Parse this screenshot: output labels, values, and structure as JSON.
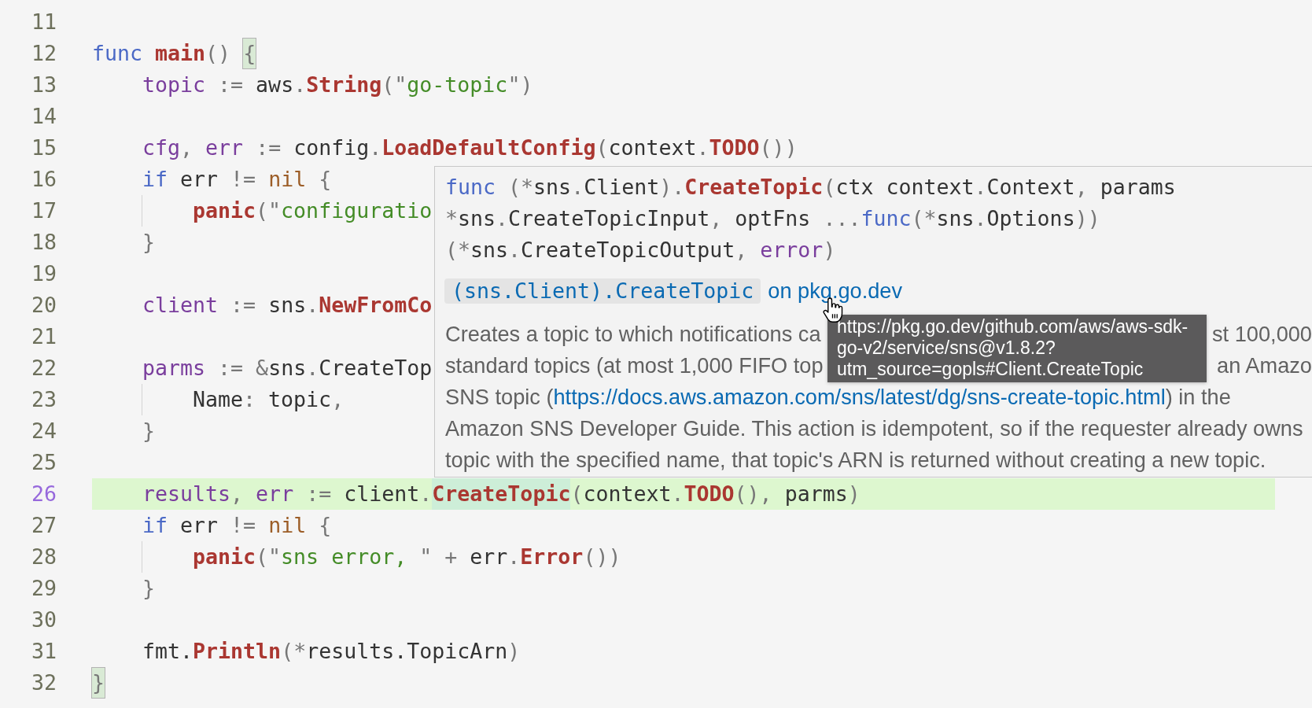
{
  "editor": {
    "lines": [
      {
        "number": "11",
        "current": false
      },
      {
        "number": "12",
        "current": false,
        "tokens": [
          {
            "kind": "keyword",
            "text": "func ",
            "matched": false
          },
          {
            "kind": "function",
            "text": "main",
            "matched": false
          },
          {
            "kind": "punct",
            "text": "() ",
            "matched": false
          },
          {
            "kind": "punct",
            "text": "{",
            "matched": true
          }
        ],
        "children": [
          {
            "number": "13",
            "current": false,
            "tokens": [
              {
                "kind": "variable",
                "text": "topic"
              },
              {
                "kind": "punct",
                "text": " := "
              },
              {
                "kind": "plain",
                "text": "aws"
              },
              {
                "kind": "punct",
                "text": "."
              },
              {
                "kind": "function",
                "text": "String"
              },
              {
                "kind": "punct",
                "text": "(\""
              },
              {
                "kind": "string",
                "text": "go-topic"
              },
              {
                "kind": "punct",
                "text": "\")"
              }
            ]
          },
          {
            "number": "14",
            "current": false
          },
          {
            "number": "15",
            "current": false,
            "tokens": [
              {
                "kind": "variable",
                "text": "cfg"
              },
              {
                "kind": "punct",
                "text": ", "
              },
              {
                "kind": "variable",
                "text": "err"
              },
              {
                "kind": "punct",
                "text": " := "
              },
              {
                "kind": "plain",
                "text": "config"
              },
              {
                "kind": "punct",
                "text": "."
              },
              {
                "kind": "function",
                "text": "LoadDefaultConfig"
              },
              {
                "kind": "punct",
                "text": "("
              },
              {
                "kind": "plain",
                "text": "context"
              },
              {
                "kind": "punct",
                "text": "."
              },
              {
                "kind": "function",
                "text": "TODO"
              },
              {
                "kind": "punct",
                "text": "())"
              }
            ]
          },
          {
            "number": "16",
            "current": false,
            "tokens": [
              {
                "kind": "keyword",
                "text": "if "
              },
              {
                "kind": "plain",
                "text": "err "
              },
              {
                "kind": "punct",
                "text": "!= "
              },
              {
                "kind": "constant",
                "text": "nil "
              },
              {
                "kind": "punct",
                "text": "{"
              }
            ],
            "children": [
              {
                "number": "17",
                "current": false,
                "tokens": [
                  {
                    "kind": "function",
                    "text": "panic"
                  },
                  {
                    "kind": "punct",
                    "text": "(\""
                  },
                  {
                    "kind": "string",
                    "text": "configuratio"
                  }
                ]
              }
            ]
          },
          {
            "number": "18",
            "current": false,
            "tokens": [
              {
                "kind": "punct",
                "text": "}"
              }
            ]
          },
          {
            "number": "19",
            "current": false
          },
          {
            "number": "20",
            "current": false,
            "tokens": [
              {
                "kind": "variable",
                "text": "client"
              },
              {
                "kind": "punct",
                "text": " := "
              },
              {
                "kind": "plain",
                "text": "sns"
              },
              {
                "kind": "punct",
                "text": "."
              },
              {
                "kind": "function",
                "text": "NewFromCo"
              }
            ]
          },
          {
            "number": "21",
            "current": false
          },
          {
            "number": "22",
            "current": false,
            "tokens": [
              {
                "kind": "variable",
                "text": "parms"
              },
              {
                "kind": "punct",
                "text": " := &"
              },
              {
                "kind": "plain",
                "text": "sns"
              },
              {
                "kind": "punct",
                "text": "."
              },
              {
                "kind": "plain",
                "text": "CreateTop"
              }
            ],
            "children": [
              {
                "number": "23",
                "current": false,
                "tokens": [
                  {
                    "kind": "plain",
                    "text": "Name"
                  },
                  {
                    "kind": "punct",
                    "text": ": "
                  },
                  {
                    "kind": "plain",
                    "text": "topic"
                  },
                  {
                    "kind": "punct",
                    "text": ","
                  }
                ]
              }
            ]
          },
          {
            "number": "24",
            "current": false,
            "tokens": [
              {
                "kind": "punct",
                "text": "}"
              }
            ]
          },
          {
            "number": "25",
            "current": false
          },
          {
            "number": "26",
            "current": true,
            "tokens": [
              {
                "kind": "variable",
                "text": "results",
                "hovered": false
              },
              {
                "kind": "punct",
                "text": ", ",
                "hovered": false
              },
              {
                "kind": "variable",
                "text": "err",
                "hovered": false
              },
              {
                "kind": "punct",
                "text": " := ",
                "hovered": false
              },
              {
                "kind": "plain",
                "text": "client",
                "hovered": false
              },
              {
                "kind": "punct",
                "text": ".",
                "hovered": false
              },
              {
                "kind": "function",
                "text": "CreateTopic",
                "hovered": true
              },
              {
                "kind": "punct",
                "text": "(",
                "hovered": false
              },
              {
                "kind": "plain",
                "text": "context",
                "hovered": false
              },
              {
                "kind": "punct",
                "text": ".",
                "hovered": false
              },
              {
                "kind": "function",
                "text": "TODO",
                "hovered": false
              },
              {
                "kind": "punct",
                "text": "(), ",
                "hovered": false
              },
              {
                "kind": "plain",
                "text": "parms",
                "hovered": false
              },
              {
                "kind": "punct",
                "text": ")",
                "hovered": false
              }
            ]
          },
          {
            "number": "27",
            "current": false,
            "tokens": [
              {
                "kind": "keyword",
                "text": "if "
              },
              {
                "kind": "plain",
                "text": "err "
              },
              {
                "kind": "punct",
                "text": "!= "
              },
              {
                "kind": "constant",
                "text": "nil "
              },
              {
                "kind": "punct",
                "text": "{"
              }
            ],
            "children": [
              {
                "number": "28",
                "current": false,
                "tokens": [
                  {
                    "kind": "function",
                    "text": "panic"
                  },
                  {
                    "kind": "punct",
                    "text": "(\""
                  },
                  {
                    "kind": "string",
                    "text": "sns error, "
                  },
                  {
                    "kind": "punct",
                    "text": "\" + "
                  },
                  {
                    "kind": "plain",
                    "text": "err"
                  },
                  {
                    "kind": "punct",
                    "text": "."
                  },
                  {
                    "kind": "function",
                    "text": "Error"
                  },
                  {
                    "kind": "punct",
                    "text": "())"
                  }
                ]
              }
            ]
          },
          {
            "number": "29",
            "current": false,
            "tokens": [
              {
                "kind": "punct",
                "text": "}"
              }
            ]
          },
          {
            "number": "30",
            "current": false
          },
          {
            "number": "31",
            "current": false,
            "tokens": [
              {
                "kind": "plain",
                "text": "fmt."
              },
              {
                "kind": "function",
                "text": "Println"
              },
              {
                "kind": "punct",
                "text": "(*"
              },
              {
                "kind": "plain",
                "text": "results.TopicArn"
              },
              {
                "kind": "punct",
                "text": ")"
              }
            ]
          }
        ]
      },
      {
        "number": "32",
        "current": false,
        "tokens": [
          {
            "kind": "punct",
            "text": "}",
            "matched": true
          }
        ]
      }
    ]
  },
  "hover": {
    "signature": [
      {
        "tokens": [
          {
            "kind": "keyword",
            "text": "func "
          },
          {
            "kind": "punct",
            "text": "(*"
          },
          {
            "kind": "plain",
            "text": "sns"
          },
          {
            "kind": "punct",
            "text": "."
          },
          {
            "kind": "plain",
            "text": "Client"
          },
          {
            "kind": "punct",
            "text": ")."
          },
          {
            "kind": "function",
            "text": "CreateTopic"
          },
          {
            "kind": "punct",
            "text": "("
          },
          {
            "kind": "plain",
            "text": "ctx context"
          },
          {
            "kind": "punct",
            "text": "."
          },
          {
            "kind": "plain",
            "text": "Context"
          },
          {
            "kind": "punct",
            "text": ", "
          },
          {
            "kind": "plain",
            "text": "params"
          }
        ]
      },
      {
        "tokens": [
          {
            "kind": "punct",
            "text": "*"
          },
          {
            "kind": "plain",
            "text": "sns"
          },
          {
            "kind": "punct",
            "text": "."
          },
          {
            "kind": "plain",
            "text": "CreateTopicInput"
          },
          {
            "kind": "punct",
            "text": ", "
          },
          {
            "kind": "plain",
            "text": "optFns "
          },
          {
            "kind": "punct",
            "text": "..."
          },
          {
            "kind": "keyword",
            "text": "func"
          },
          {
            "kind": "punct",
            "text": "(*"
          },
          {
            "kind": "plain",
            "text": "sns"
          },
          {
            "kind": "punct",
            "text": "."
          },
          {
            "kind": "plain",
            "text": "Options"
          },
          {
            "kind": "punct",
            "text": "))"
          }
        ]
      },
      {
        "tokens": [
          {
            "kind": "punct",
            "text": "(*"
          },
          {
            "kind": "plain",
            "text": "sns"
          },
          {
            "kind": "punct",
            "text": "."
          },
          {
            "kind": "plain",
            "text": "CreateTopicOutput"
          },
          {
            "kind": "punct",
            "text": ", "
          },
          {
            "kind": "variable",
            "text": "error"
          },
          {
            "kind": "punct",
            "text": ")"
          }
        ]
      }
    ],
    "doc_link": {
      "code": "(sns.Client).CreateTopic",
      "text": "on pkg.go.dev"
    },
    "description": [
      {
        "segments": [
          {
            "kind": "text",
            "text": "Creates a topic to which notifications ca"
          },
          {
            "kind": "after_tooltip",
            "text": "st 100,000"
          }
        ]
      },
      {
        "segments": [
          {
            "kind": "text",
            "text": "standard topics (at most 1,000 FIFO top"
          },
          {
            "kind": "after_tooltip",
            "text": "an Amazo"
          }
        ]
      },
      {
        "segments": [
          {
            "kind": "text",
            "text": "SNS topic ("
          },
          {
            "kind": "link",
            "text": "https://docs.aws.amazon.com/sns/latest/dg/sns-create-topic.html"
          },
          {
            "kind": "text",
            "text": ") in the"
          }
        ]
      },
      {
        "segments": [
          {
            "kind": "text",
            "text": "Amazon SNS Developer Guide. This action is idempotent, so if the requester already owns"
          }
        ]
      },
      {
        "segments": [
          {
            "kind": "text",
            "text": "topic with the specified name, that topic's ARN is returned without creating a new topic."
          }
        ]
      }
    ]
  },
  "tooltip": {
    "lines": [
      "https://pkg.go.dev/github.com/aws/aws-sdk-",
      "go-v2/service/sns@v1.8.2?",
      "utm_source=gopls#Client.CreateTopic"
    ]
  }
}
